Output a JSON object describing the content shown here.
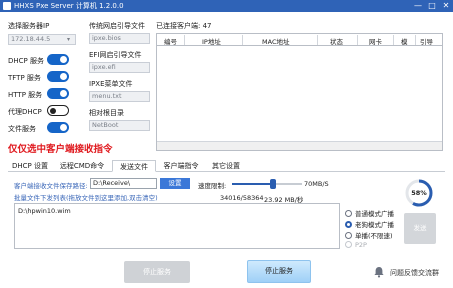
{
  "window": {
    "title": "HHXS Pxe Server 计算机 1.2.0.0",
    "minimize_glyph": "—",
    "maximize_glyph": "□",
    "close_glyph": "✕"
  },
  "left_panel": {
    "server_ip_label": "选择服务器IP",
    "server_ip_value": "172.18.44.5",
    "dhcp_label": "DHCP 服务",
    "tftp_label": "TFTP 服务",
    "http_label": "HTTP 服务",
    "proxy_dhcp_label": "代理DHCP",
    "file_service_label": "文件服务",
    "toggles": {
      "dhcp": true,
      "tftp": true,
      "http": true,
      "proxy_dhcp": false,
      "file_service": true
    }
  },
  "boot_files": {
    "legacy_label": "传统网启引导文件",
    "legacy_value": "ipxe.bios",
    "efi_label": "EFI网启引导文件",
    "efi_value": "ipxe.efi",
    "ipxe_menu_label": "IPXE菜单文件",
    "ipxe_menu_value": "menu.txt",
    "relative_dir_label": "相对根目录",
    "relative_dir_value": "NetBoot"
  },
  "warning_text": "仅仅选中客户端接收指令",
  "clients": {
    "count_label": "已连接客户端: 47",
    "columns": [
      "编号",
      "IP地址",
      "MAC地址",
      "状态",
      "网卡",
      "模",
      "引导"
    ]
  },
  "tabs": [
    "DHCP 设置",
    "远程CMD命令",
    "发送文件",
    "客户端指令",
    "其它设置"
  ],
  "active_tab": "发送文件",
  "send_file": {
    "save_path_label": "客户端接收文件保存路径:",
    "save_path_value": "D:\\Receive\\",
    "set_button": "设置",
    "speed_limit_label": "速度限制:",
    "speed_limit_value": "70MB/S",
    "speed_limit_fraction": 0.6,
    "batch_label": "批量文件下发列表(拖放文件到这里添加,双击清空)",
    "progress_count": "34016/58364",
    "progress_speed": "23.92 MB/秒",
    "files": [
      "D:\\hpwin10.wim"
    ],
    "modes": [
      "普通模式广播",
      "老狗模式广播",
      "单播(不限速)",
      "P2P"
    ],
    "selected_mode": "老狗模式广播",
    "percent": "58%",
    "percent_value": 0.58,
    "send_button": "发送"
  },
  "footer": {
    "stop_service_disabled": "停止服务",
    "stop_service": "停止服务",
    "feedback": "问题反馈交流群"
  },
  "colors": {
    "accent": "#2f63b7",
    "toggle_on": "#1565c8",
    "warning": "#e0191e",
    "link_label": "#3a67b8"
  }
}
